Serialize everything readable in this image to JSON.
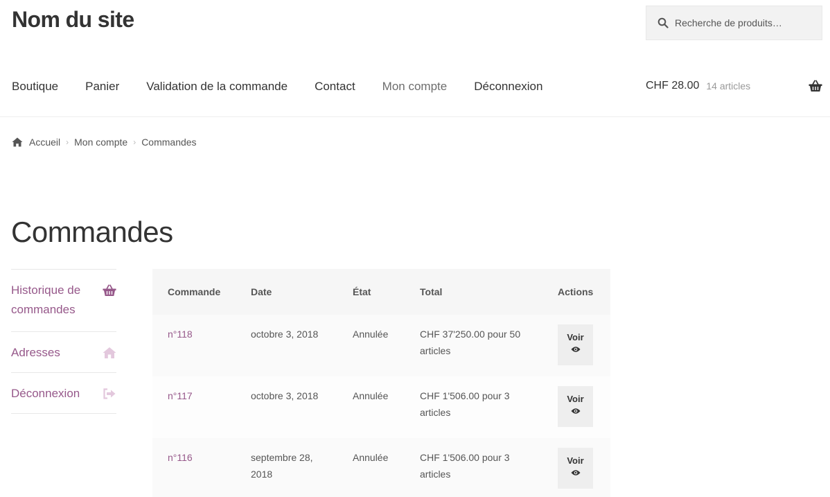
{
  "site": {
    "title": "Nom du site"
  },
  "search": {
    "placeholder": "Recherche de produits…"
  },
  "nav": {
    "items": [
      {
        "label": "Boutique"
      },
      {
        "label": "Panier"
      },
      {
        "label": "Validation de la commande"
      },
      {
        "label": "Contact"
      },
      {
        "label": "Mon compte",
        "current": true
      },
      {
        "label": "Déconnexion"
      }
    ]
  },
  "cart": {
    "amount": "CHF 28.00",
    "count": "14 articles",
    "icon": "basket-icon"
  },
  "breadcrumb": {
    "items": [
      "Accueil",
      "Mon compte",
      "Commandes"
    ]
  },
  "page": {
    "title": "Commandes"
  },
  "account_nav": {
    "items": [
      {
        "label": "Historique de commandes",
        "icon": "basket-icon"
      },
      {
        "label": "Adresses",
        "icon": "home-icon"
      },
      {
        "label": "Déconnexion",
        "icon": "sign-out-icon"
      }
    ]
  },
  "orders": {
    "headers": [
      "Commande",
      "Date",
      "État",
      "Total",
      "Actions"
    ],
    "rows": [
      {
        "number": "n°118",
        "date": "octobre 3, 2018",
        "status": "Annulée",
        "total": "CHF 37'250.00 pour 50 articles",
        "action": "Voir"
      },
      {
        "number": "n°117",
        "date": "octobre 3, 2018",
        "status": "Annulée",
        "total": "CHF 1'506.00 pour 3 articles",
        "action": "Voir"
      },
      {
        "number": "n°116",
        "date": "septembre 28, 2018",
        "status": "Annulée",
        "total": "CHF 1'506.00 pour 3 articles",
        "action": "Voir"
      }
    ]
  },
  "colors": {
    "accent": "#96588a",
    "text": "#333333",
    "muted": "#6d6d6d"
  }
}
